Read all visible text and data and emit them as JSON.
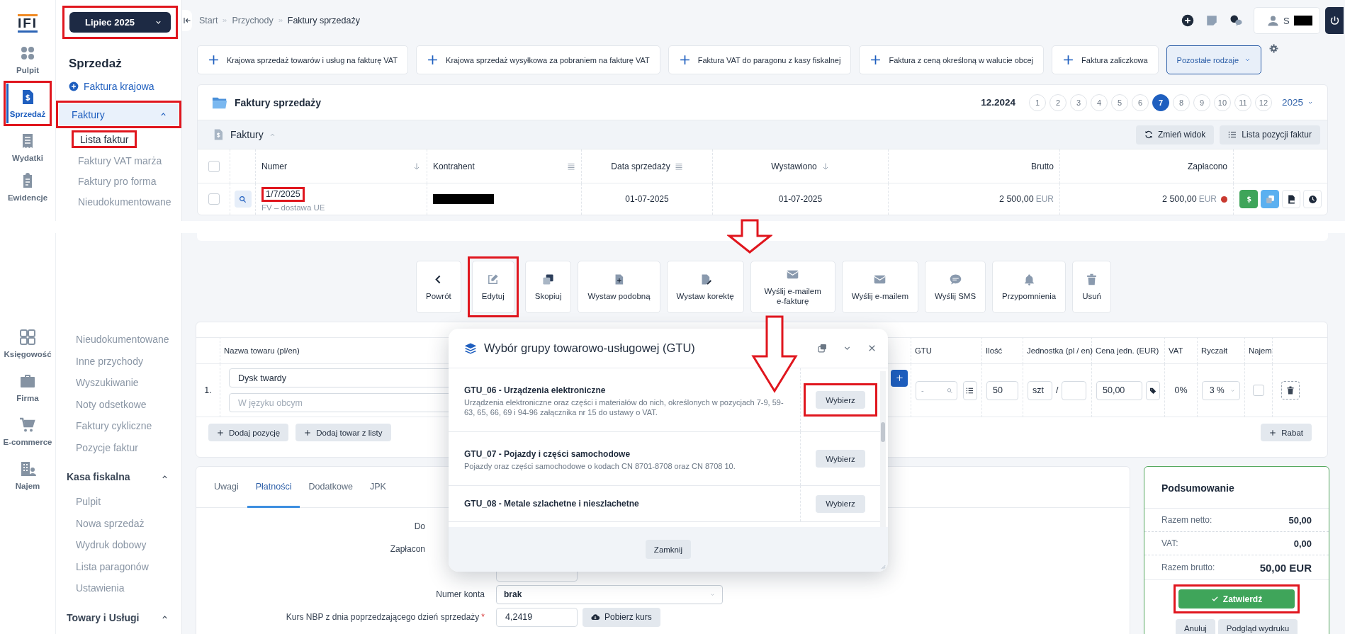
{
  "logo": "IFI",
  "period_selector": {
    "label": "Lipiec 2025",
    "highlighted": true
  },
  "rail_top": [
    {
      "label": "Pulpit",
      "kind": "dots",
      "selected": false,
      "highlighted": false
    },
    {
      "label": "Sprzedaż",
      "kind": "invoice",
      "selected": true,
      "highlighted": true
    },
    {
      "label": "Wydatki",
      "kind": "receipt",
      "selected": false,
      "highlighted": false
    },
    {
      "label": "Ewidencje",
      "kind": "clipboard",
      "selected": false,
      "highlighted": false
    }
  ],
  "menu_top": {
    "title": "Sprzedaż",
    "action": "Faktura krajowa",
    "group": {
      "label": "Faktury",
      "expanded": true,
      "highlighted": true
    },
    "items": [
      {
        "label": "Lista faktur",
        "selected": true,
        "highlighted": true
      },
      {
        "label": "Faktury VAT marża",
        "selected": false,
        "highlighted": false
      },
      {
        "label": "Faktury pro forma",
        "selected": false,
        "highlighted": false
      },
      {
        "label": "Nieudokumentowane",
        "selected": false,
        "highlighted": false
      }
    ]
  },
  "breadcrumb": [
    "Start",
    "Przychody",
    "Faktury sprzedaży"
  ],
  "user": {
    "initial": "S",
    "name_redacted": true
  },
  "quick_actions": [
    {
      "label": "Krajowa sprzedaż towarów i usług na fakturę VAT",
      "kind": "add"
    },
    {
      "label": "Krajowa sprzedaż wysyłkowa za pobraniem na fakturę VAT",
      "kind": "add"
    },
    {
      "label": "Faktura VAT do paragonu z kasy fiskalnej",
      "kind": "add"
    },
    {
      "label": "Faktura z ceną określoną w walucie obcej",
      "kind": "add"
    },
    {
      "label": "Faktura zaliczkowa",
      "kind": "add"
    },
    {
      "label": "Pozostałe rodzaje",
      "kind": "dropdown"
    }
  ],
  "invoices": {
    "title": "Faktury sprzedaży",
    "previous_period": "12.2024",
    "months": [
      {
        "label": "1",
        "selected": false
      },
      {
        "label": "2",
        "selected": false
      },
      {
        "label": "3",
        "selected": false
      },
      {
        "label": "4",
        "selected": false
      },
      {
        "label": "5",
        "selected": false
      },
      {
        "label": "6",
        "selected": false
      },
      {
        "label": "7",
        "selected": true
      },
      {
        "label": "8",
        "selected": false
      },
      {
        "label": "9",
        "selected": false
      },
      {
        "label": "10",
        "selected": false
      },
      {
        "label": "11",
        "selected": false
      },
      {
        "label": "12",
        "selected": false
      }
    ],
    "year": "2025",
    "section": "Faktury",
    "buttons": [
      {
        "label": "Zmień widok",
        "kind": "refresh"
      },
      {
        "label": "Lista pozycji faktur",
        "kind": "list"
      }
    ],
    "header_checked": false,
    "columns": [
      {
        "label": "Numer",
        "kind": "sort"
      },
      {
        "label": "Kontrahent",
        "kind": "menu"
      },
      {
        "label": "Data sprzedaży",
        "kind": "menu"
      },
      {
        "label": "Wystawiono",
        "kind": "sort"
      },
      {
        "label": "Brutto"
      },
      {
        "label": "Zapłacono"
      }
    ],
    "rows": [
      {
        "checked": false,
        "number": "1/7/2025",
        "number_highlighted": true,
        "type": "FV – dostawa UE",
        "counterparty_redacted": true,
        "sale_date": "01-07-2025",
        "issued": "01-07-2025",
        "gross": "2 500,00",
        "gross_currency": "EUR",
        "paid": "2 500,00",
        "paid_currency": "EUR"
      }
    ]
  },
  "toolbar": [
    {
      "label": "Powrót",
      "kind": "back",
      "highlighted": false
    },
    {
      "label": "Edytuj",
      "kind": "edit",
      "highlighted": true
    },
    {
      "label": "Skopiuj",
      "kind": "copy",
      "highlighted": false
    },
    {
      "label": "Wystaw podobną",
      "kind": "file-plus",
      "highlighted": false
    },
    {
      "label": "Wystaw korektę",
      "kind": "file-edit",
      "highlighted": false
    },
    {
      "label": "Wyślij e-mailem e-fakturę",
      "kind": "mail",
      "highlighted": false
    },
    {
      "label": "Wyślij e-mailem",
      "kind": "mail",
      "highlighted": false
    },
    {
      "label": "Wyślij SMS",
      "kind": "sms",
      "highlighted": false
    },
    {
      "label": "Przypomnienia",
      "kind": "bell",
      "highlighted": false
    },
    {
      "label": "Usuń",
      "kind": "trash",
      "highlighted": false
    }
  ],
  "rail_bottom": [
    {
      "label": "Księgowość",
      "kind": "calc"
    },
    {
      "label": "Firma",
      "kind": "briefcase"
    },
    {
      "label": "E-commerce",
      "kind": "cart"
    },
    {
      "label": "Najem",
      "kind": "building"
    }
  ],
  "menu_bottom": {
    "items": [
      "Nieudokumentowane",
      "Inne przychody",
      "Wyszukiwanie",
      "Noty odsetkowe",
      "Faktury cykliczne",
      "Pozycje faktur"
    ],
    "groups": [
      {
        "label": "Kasa fiskalna",
        "expanded": true,
        "items": [
          "Pulpit",
          "Nowa sprzedaż",
          "Wydruk dobowy",
          "Lista paragonów",
          "Ustawienia"
        ]
      },
      {
        "label": "Towary i Usługi",
        "expanded": true
      }
    ]
  },
  "items_table": {
    "columns": [
      "Nazwa towaru (pl/en)",
      "GTU",
      "Ilość",
      "Jednostka (pl / en)",
      "Cena jedn. (EUR)",
      "VAT",
      "Ryczałt",
      "Najem"
    ],
    "rows": [
      {
        "index": "1.",
        "name": "Dysk twardy",
        "foreign_placeholder": "W języku obcym",
        "gtu_placeholder": "-",
        "quantity": "50",
        "unit": "szt",
        "unit_separator": "/",
        "price": "50,00",
        "vat": "0%",
        "flat_rate": "3 %",
        "rental": false
      }
    ],
    "buttons": [
      "Dodaj pozycję",
      "Dodaj towar z listy"
    ],
    "discount_button": "Rabat"
  },
  "details": {
    "tabs": [
      {
        "label": "Uwagi",
        "selected": false
      },
      {
        "label": "Płatności",
        "selected": true
      },
      {
        "label": "Dodatkowe",
        "selected": false
      },
      {
        "label": "JPK",
        "selected": false
      }
    ],
    "fields": [
      {
        "label": "Do",
        "kind": "none",
        "partly_hidden": true
      },
      {
        "label": "Zapłacon",
        "kind": "none",
        "partly_hidden": true
      },
      {
        "kind": "input"
      },
      {
        "label": "Numer konta",
        "kind": "select",
        "value": "brak",
        "partly_hidden": false
      },
      {
        "label": "Kurs NBP z dnia poprzedzającego dzień sprzedaży",
        "required_mark": "*",
        "kind": "input",
        "value": "4,2419",
        "button": "Pobierz kurs",
        "partly_hidden": false
      }
    ]
  },
  "summary": {
    "title": "Podsumowanie",
    "rows": [
      {
        "label": "Razem netto:",
        "value": "50,00",
        "kind": "line"
      },
      {
        "label": "VAT:",
        "value": "0,00",
        "kind": "line"
      },
      {
        "label": "Razem brutto:",
        "value": "50,00 EUR",
        "kind": "total"
      }
    ],
    "confirm": {
      "label": "Zatwierdź",
      "highlighted": true
    },
    "buttons": [
      "Anuluj",
      "Podgląd wydruku"
    ]
  },
  "gtu_dialog": {
    "title": "Wybór grupy towarowo-usługowej (GTU)",
    "options": [
      {
        "title": "GTU_06 - Urządzenia elektroniczne",
        "description": "Urządzenia elektroniczne oraz części i materiałów do nich, określonych w pozycjach 7-9, 59-63, 65, 66, 69 i 94-96 załącznika nr 15 do ustawy o VAT.",
        "button": "Wybierz",
        "highlighted": true
      },
      {
        "title": "GTU_07 - Pojazdy i części samochodowe",
        "description": "Pojazdy oraz części samochodowe o kodach CN 8701-8708 oraz CN 8708 10.",
        "button": "Wybierz",
        "highlighted": false
      },
      {
        "title": "GTU_08 - Metale szlachetne i nieszlachetne",
        "button": "Wybierz",
        "highlighted": false
      }
    ],
    "close_button": "Zamknij"
  }
}
